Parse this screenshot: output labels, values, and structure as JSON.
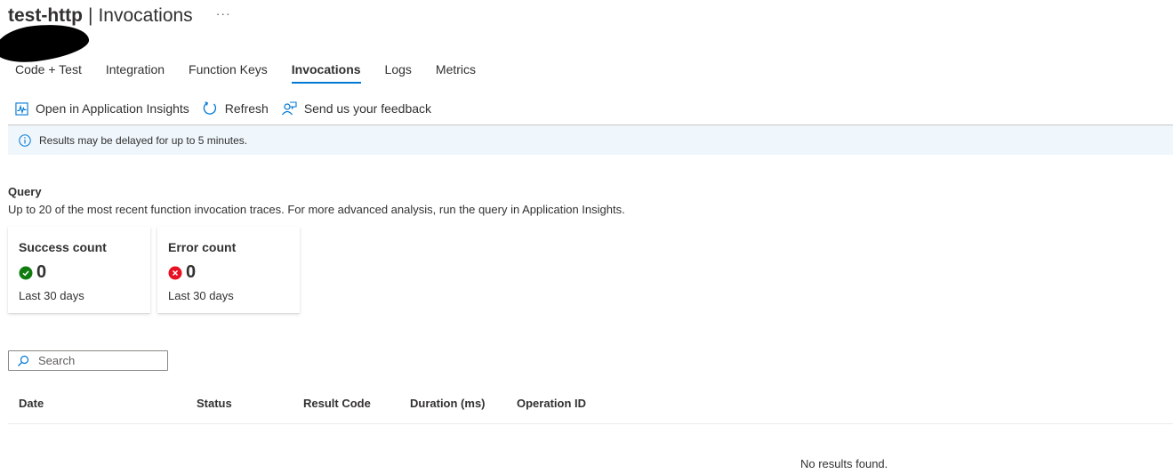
{
  "header": {
    "resource_name": "test-http",
    "separator": "|",
    "page_title": "Invocations",
    "more_label": "···"
  },
  "tabs": [
    {
      "label": "Code + Test",
      "active": false
    },
    {
      "label": "Integration",
      "active": false
    },
    {
      "label": "Function Keys",
      "active": false
    },
    {
      "label": "Invocations",
      "active": true
    },
    {
      "label": "Logs",
      "active": false
    },
    {
      "label": "Metrics",
      "active": false
    }
  ],
  "toolbar": {
    "open_insights_label": "Open in Application Insights",
    "refresh_label": "Refresh",
    "feedback_label": "Send us your feedback"
  },
  "banner": {
    "icon": "info-icon",
    "text": "Results may be delayed for up to 5 minutes."
  },
  "query": {
    "title": "Query",
    "description": "Up to 20 of the most recent function invocation traces. For more advanced analysis, run the query in Application Insights."
  },
  "cards": {
    "success": {
      "title": "Success count",
      "value": "0",
      "period": "Last 30 days",
      "icon": "success-check-icon",
      "color": "#107c10"
    },
    "error": {
      "title": "Error count",
      "value": "0",
      "period": "Last 30 days",
      "icon": "error-x-icon",
      "color": "#e81123"
    }
  },
  "search": {
    "placeholder": "Search",
    "value": ""
  },
  "table": {
    "columns": [
      "Date",
      "Status",
      "Result Code",
      "Duration (ms)",
      "Operation ID"
    ],
    "rows": [],
    "empty_message": "No results found."
  },
  "colors": {
    "accent": "#0078d4",
    "banner_bg": "#eff6fc"
  }
}
